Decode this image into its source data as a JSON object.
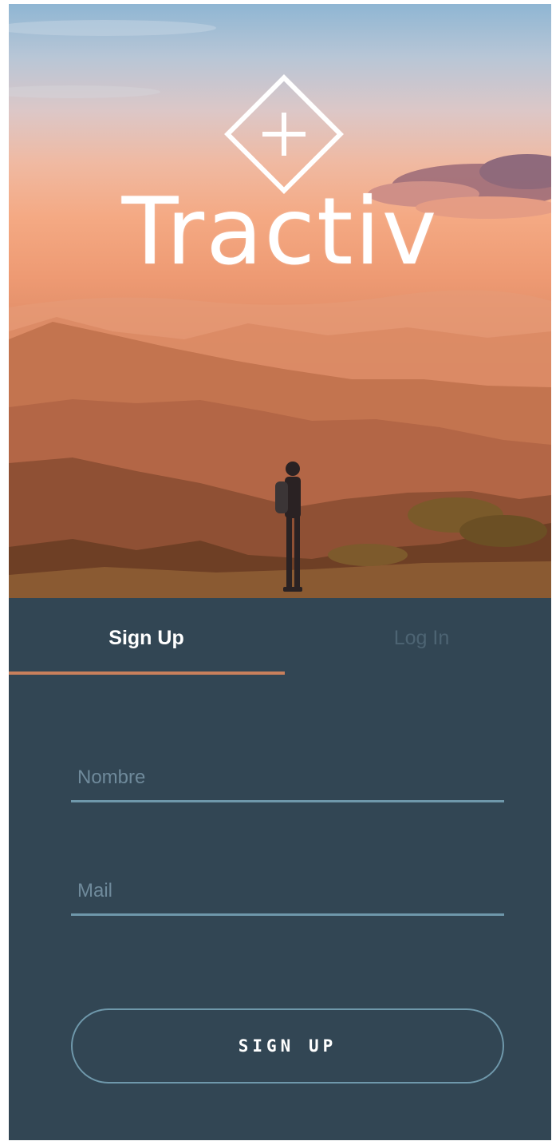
{
  "app": {
    "brand_name": "Tractiv",
    "logo_icon": "diamond-plus-icon"
  },
  "tabs": [
    {
      "label": "Sign Up",
      "active": true
    },
    {
      "label": "Log In",
      "active": false
    }
  ],
  "form": {
    "name_field": {
      "placeholder": "Nombre",
      "value": ""
    },
    "mail_field": {
      "placeholder": "Mail",
      "value": ""
    },
    "submit_label": "SIGN UP"
  },
  "colors": {
    "panel_background": "#324654",
    "tab_indicator": "#c9805c",
    "field_underline": "#6f98ab",
    "inactive_tab_text": "#4d6473"
  }
}
